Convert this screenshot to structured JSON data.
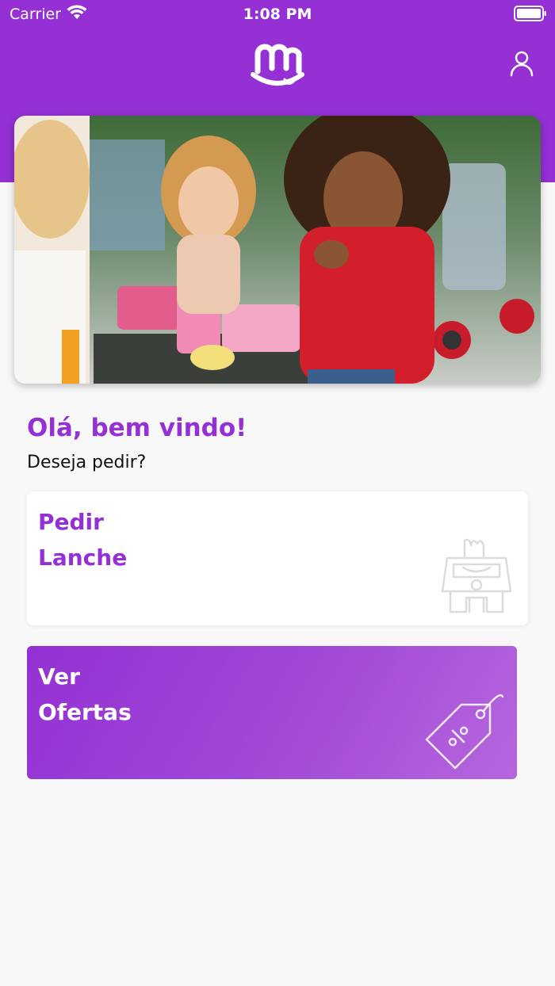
{
  "status_bar": {
    "carrier": "Carrier",
    "time": "1:08 PM"
  },
  "header": {
    "logo": "m-smile-logo",
    "profile_icon": "user-icon"
  },
  "hero": {
    "image": "children-eating-snacks-photo"
  },
  "greeting": {
    "title": "Olá, bem vindo!",
    "subtitle": "Deseja pedir?"
  },
  "cards": [
    {
      "line1": "Pedir",
      "line2": "Lanche",
      "icon": "snack-stand-icon"
    },
    {
      "line1": "Ver",
      "line2": "Ofertas",
      "icon": "discount-tag-icon"
    }
  ],
  "colors": {
    "primary": "#9430d4",
    "background": "#f8f8f8"
  }
}
